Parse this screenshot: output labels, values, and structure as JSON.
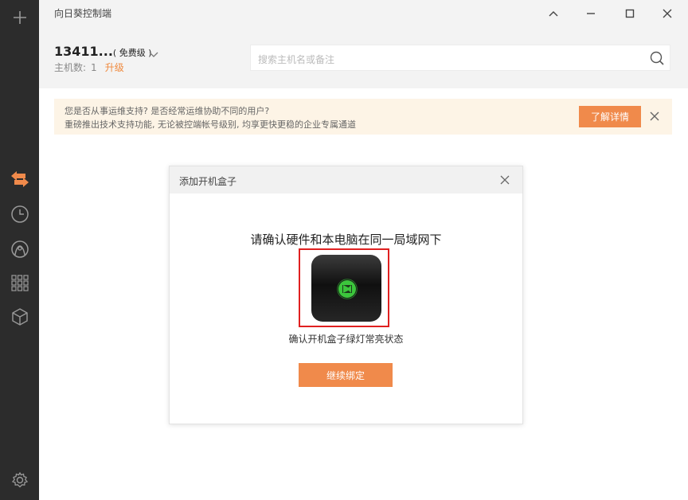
{
  "window": {
    "title": "向日葵控制端"
  },
  "sidebar": {
    "items": [
      {
        "icon": "plus-icon"
      },
      {
        "icon": "remote-arrows-icon",
        "active": true
      },
      {
        "icon": "clock-icon"
      },
      {
        "icon": "discover-icon"
      },
      {
        "icon": "apps-grid-icon"
      },
      {
        "icon": "cube-icon"
      },
      {
        "icon": "gear-icon"
      }
    ],
    "accent": "#f08a4b"
  },
  "account": {
    "id": "13411...",
    "tier": "( 免费级 )",
    "host_count_label": "主机数:",
    "host_count": "1",
    "upgrade_label": "升级"
  },
  "search": {
    "placeholder": "搜索主机名或备注"
  },
  "notice": {
    "line1": "您是否从事运维支持? 是否经常运维协助不同的用户?",
    "line2": "重磅推出技术支持功能, 无论被控端帐号级别, 均享更快更稳的企业专属通道",
    "button": "了解详情"
  },
  "dialog": {
    "title": "添加开机盒子",
    "heading": "请确认硬件和本电脑在同一局域网下",
    "caption": "确认开机盒子绿灯常亮状态",
    "button": "继续绑定"
  },
  "colors": {
    "accent": "#f08a4b",
    "highlight_frame": "#e02020",
    "device_led": "#3cc63c"
  }
}
